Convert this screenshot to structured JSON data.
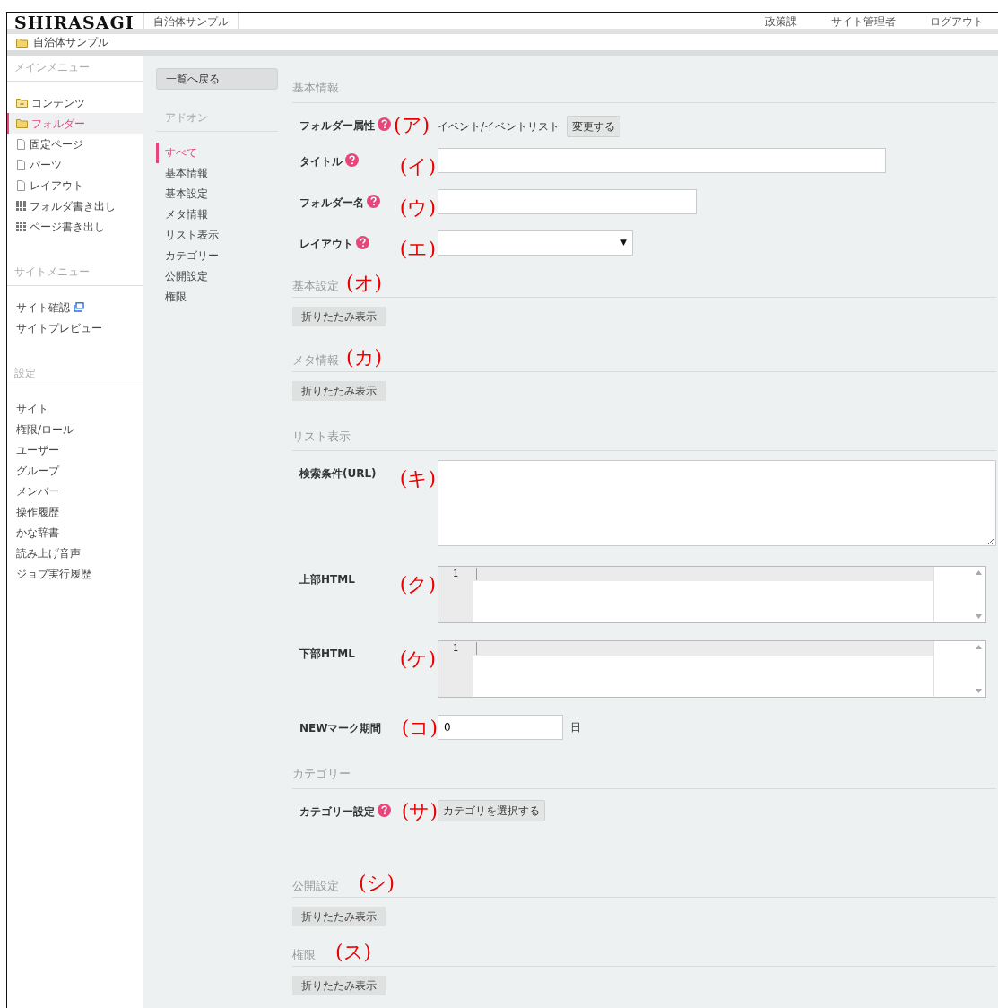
{
  "header": {
    "logo": "SHIRASAGI",
    "site_name": "自治体サンプル",
    "links": [
      "政策課",
      "サイト管理者",
      "ログアウト"
    ]
  },
  "breadcrumb": {
    "label": "自治体サンプル"
  },
  "sidebar": {
    "sections": [
      {
        "title": "メインメニュー",
        "items": [
          {
            "label": "コンテンツ",
            "kind": "folder-plus",
            "selected": false
          },
          {
            "label": "フォルダー",
            "kind": "folder",
            "selected": true
          },
          {
            "label": "固定ページ",
            "kind": "page",
            "selected": false
          },
          {
            "label": "パーツ",
            "kind": "page",
            "selected": false
          },
          {
            "label": "レイアウト",
            "kind": "page",
            "selected": false
          },
          {
            "label": "フォルダ書き出し",
            "kind": "grid",
            "selected": false
          },
          {
            "label": "ページ書き出し",
            "kind": "grid",
            "selected": false
          }
        ]
      },
      {
        "title": "サイトメニュー",
        "items": [
          {
            "label": "サイト確認",
            "kind": "external",
            "selected": false
          },
          {
            "label": "サイトプレビュー",
            "kind": "plain",
            "selected": false
          }
        ]
      },
      {
        "title": "設定",
        "items": [
          {
            "label": "サイト",
            "kind": "plain",
            "selected": false
          },
          {
            "label": "権限/ロール",
            "kind": "plain",
            "selected": false
          },
          {
            "label": "ユーザー",
            "kind": "plain",
            "selected": false
          },
          {
            "label": "グループ",
            "kind": "plain",
            "selected": false
          },
          {
            "label": "メンバー",
            "kind": "plain",
            "selected": false
          },
          {
            "label": "操作履歴",
            "kind": "plain",
            "selected": false
          },
          {
            "label": "かな辞書",
            "kind": "plain",
            "selected": false
          },
          {
            "label": "読み上げ音声",
            "kind": "plain",
            "selected": false
          },
          {
            "label": "ジョブ実行履歴",
            "kind": "plain",
            "selected": false
          }
        ]
      }
    ]
  },
  "subnav": {
    "back_button": "一覧へ戻る",
    "heading": "アドオン",
    "items": [
      {
        "label": "すべて",
        "selected": true
      },
      {
        "label": "基本情報",
        "selected": false
      },
      {
        "label": "基本設定",
        "selected": false
      },
      {
        "label": "メタ情報",
        "selected": false
      },
      {
        "label": "リスト表示",
        "selected": false
      },
      {
        "label": "カテゴリー",
        "selected": false
      },
      {
        "label": "公開設定",
        "selected": false
      },
      {
        "label": "権限",
        "selected": false
      }
    ]
  },
  "sections": [
    {
      "title": "基本情報",
      "fields": [
        {
          "kind": "value",
          "label": "フォルダー属性",
          "help": true,
          "annotation": "(ア)",
          "value": "イベント/イベントリスト",
          "button": "変更する"
        },
        {
          "kind": "text",
          "label": "タイトル",
          "help": true,
          "annotation": "(イ)"
        },
        {
          "kind": "short-text",
          "label": "フォルダー名",
          "help": true,
          "annotation": "(ウ)"
        },
        {
          "kind": "select",
          "label": "レイアウト",
          "help": true,
          "annotation": "(エ)",
          "arrow": "▼"
        }
      ]
    },
    {
      "title": "基本設定",
      "annotation": "(オ)",
      "collapse_button": "折りたたみ表示"
    },
    {
      "title": "メタ情報",
      "annotation": "(カ)",
      "collapse_button": "折りたたみ表示"
    },
    {
      "title": "リスト表示",
      "fields": [
        {
          "kind": "textarea",
          "label": "検索条件(URL)",
          "help": false,
          "annotation": "(キ)"
        },
        {
          "kind": "code",
          "label": "上部HTML",
          "help": false,
          "annotation": "(ク)",
          "line_number": "1"
        },
        {
          "kind": "code",
          "label": "下部HTML",
          "help": false,
          "annotation": "(ケ)",
          "line_number": "1"
        },
        {
          "kind": "number",
          "label": "NEWマーク期間",
          "help": false,
          "annotation": "(コ)",
          "value": "0",
          "unit": "日"
        }
      ]
    },
    {
      "title": "カテゴリー",
      "fields": [
        {
          "kind": "button",
          "label": "カテゴリー設定",
          "help": true,
          "annotation": "(サ)",
          "button": "カテゴリを選択する"
        }
      ]
    },
    {
      "title": "公開設定",
      "annotation": "(シ)",
      "collapse_button": "折りたたみ表示"
    },
    {
      "title": "権限",
      "annotation": "(ス)",
      "collapse_button": "折りたたみ表示"
    }
  ]
}
